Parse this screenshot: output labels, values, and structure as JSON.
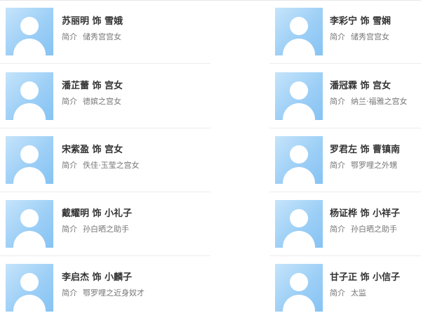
{
  "cast": [
    {
      "name": "苏丽明 饰 雪娥",
      "intro_label": "简介",
      "intro": "储秀宫宫女"
    },
    {
      "name": "李彩宁 饰 雪娴",
      "intro_label": "简介",
      "intro": "储秀宫宫女"
    },
    {
      "name": "潘芷蕾 饰 宫女",
      "intro_label": "简介",
      "intro": "德嫔之宫女"
    },
    {
      "name": "潘冠霖 饰 宫女",
      "intro_label": "简介",
      "intro": "纳兰·福雅之宫女"
    },
    {
      "name": "宋紫盈 饰 宫女",
      "intro_label": "简介",
      "intro": "佚佳·玉莹之宫女"
    },
    {
      "name": "罗君左 饰 曹镇南",
      "intro_label": "简介",
      "intro": "鄂罗哩之外甥"
    },
    {
      "name": "戴耀明 饰 小礼子",
      "intro_label": "简介",
      "intro": "孙白晒之助手"
    },
    {
      "name": "杨证桦 饰 小祥子",
      "intro_label": "简介",
      "intro": "孙白晒之助手"
    },
    {
      "name": "李启杰 饰 小麟子",
      "intro_label": "简介",
      "intro": "鄂罗哩之近身奴才"
    },
    {
      "name": "甘子正 饰 小信子",
      "intro_label": "简介",
      "intro": "太监"
    }
  ]
}
